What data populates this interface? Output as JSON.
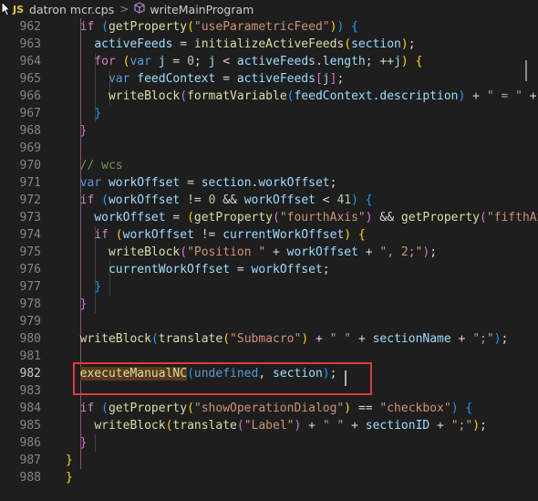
{
  "breadcrumb": {
    "badge": "JS",
    "file": "datron mcr.cps",
    "separator": ">",
    "symbol": "writeMainProgram"
  },
  "lines": [
    {
      "num": "962",
      "code": "    if (getProperty(\"useParametricFeed\")) {"
    },
    {
      "num": "963",
      "code": "      activeFeeds = initializeActiveFeeds(section);"
    },
    {
      "num": "964",
      "code": "      for (var j = 0; j < activeFeeds.length; ++j) {"
    },
    {
      "num": "965",
      "code": "        var feedContext = activeFeeds[j];"
    },
    {
      "num": "966",
      "code": "        writeBlock(formatVariable(feedContext.description) + \" = \" +"
    },
    {
      "num": "967",
      "code": "      }"
    },
    {
      "num": "968",
      "code": "    }"
    },
    {
      "num": "969",
      "code": ""
    },
    {
      "num": "970",
      "code": "    // wcs"
    },
    {
      "num": "971",
      "code": "    var workOffset = section.workOffset;"
    },
    {
      "num": "972",
      "code": "    if (workOffset != 0 && workOffset < 41) {"
    },
    {
      "num": "973",
      "code": "      workOffset = (getProperty(\"fourthAxis\") && getProperty(\"fifthAx"
    },
    {
      "num": "974",
      "code": "      if (workOffset != currentWorkOffset) {"
    },
    {
      "num": "975",
      "code": "        writeBlock(\"Position \" + workOffset + \", 2;\");"
    },
    {
      "num": "976",
      "code": "        currentWorkOffset = workOffset;"
    },
    {
      "num": "977",
      "code": "      }"
    },
    {
      "num": "978",
      "code": "    }"
    },
    {
      "num": "979",
      "code": ""
    },
    {
      "num": "980",
      "code": "    writeBlock(translate(\"Submacro\") + \" \" + sectionName + \";\");"
    },
    {
      "num": "981",
      "code": ""
    },
    {
      "num": "982",
      "code": "    executeManualNC(undefined, section);"
    },
    {
      "num": "983",
      "code": ""
    },
    {
      "num": "984",
      "code": "    if (getProperty(\"showOperationDialog\") == \"checkbox\") {"
    },
    {
      "num": "985",
      "code": "      writeBlock(translate(\"Label\") + \" \" + sectionID + \";\");"
    },
    {
      "num": "986",
      "code": "    }"
    },
    {
      "num": "987",
      "code": "  }"
    },
    {
      "num": "988",
      "code": "}"
    }
  ],
  "active_line": "982",
  "icons": {
    "badge": "js-file-icon",
    "symbol": "method-cube-icon",
    "cursor": "mouse-pointer-icon"
  },
  "colors": {
    "background": "#1e1e1e",
    "highlight_border": "#e03c3c"
  }
}
